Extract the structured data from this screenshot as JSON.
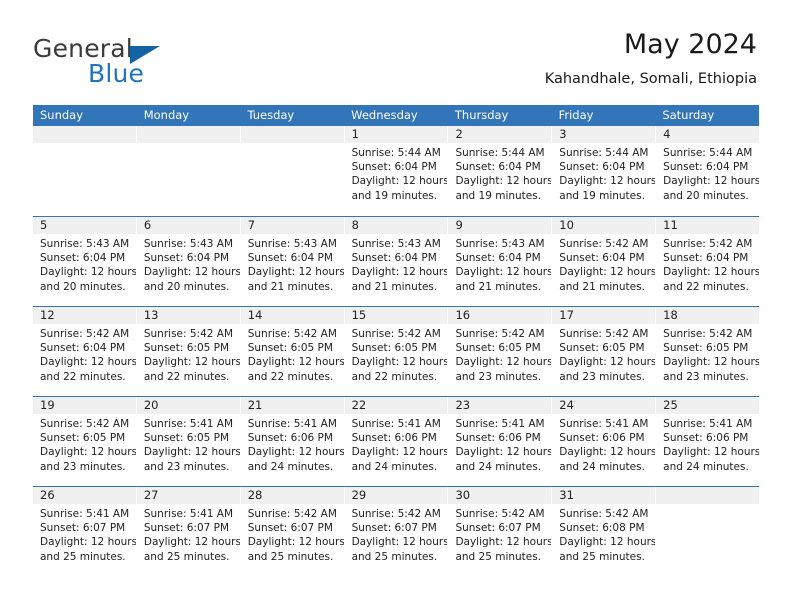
{
  "brand": {
    "name_part1": "General",
    "name_part2": "Blue",
    "triangle_icon": "triangle-icon",
    "accent_color": "#1464a5"
  },
  "header": {
    "title": "May 2024",
    "subtitle": "Kahandhale, Somali, Ethiopia"
  },
  "calendar": {
    "header_color": "#3275b8",
    "daynum_bg": "#f0f0f0",
    "day_names": [
      "Sunday",
      "Monday",
      "Tuesday",
      "Wednesday",
      "Thursday",
      "Friday",
      "Saturday"
    ],
    "weeks": [
      [
        {
          "day": "",
          "empty": true,
          "sunrise": "",
          "sunset": "",
          "daylight1": "",
          "daylight2": ""
        },
        {
          "day": "",
          "empty": true,
          "sunrise": "",
          "sunset": "",
          "daylight1": "",
          "daylight2": ""
        },
        {
          "day": "",
          "empty": true,
          "sunrise": "",
          "sunset": "",
          "daylight1": "",
          "daylight2": ""
        },
        {
          "day": "1",
          "empty": false,
          "sunrise": "Sunrise: 5:44 AM",
          "sunset": "Sunset: 6:04 PM",
          "daylight1": "Daylight: 12 hours",
          "daylight2": "and 19 minutes."
        },
        {
          "day": "2",
          "empty": false,
          "sunrise": "Sunrise: 5:44 AM",
          "sunset": "Sunset: 6:04 PM",
          "daylight1": "Daylight: 12 hours",
          "daylight2": "and 19 minutes."
        },
        {
          "day": "3",
          "empty": false,
          "sunrise": "Sunrise: 5:44 AM",
          "sunset": "Sunset: 6:04 PM",
          "daylight1": "Daylight: 12 hours",
          "daylight2": "and 19 minutes."
        },
        {
          "day": "4",
          "empty": false,
          "sunrise": "Sunrise: 5:44 AM",
          "sunset": "Sunset: 6:04 PM",
          "daylight1": "Daylight: 12 hours",
          "daylight2": "and 20 minutes."
        }
      ],
      [
        {
          "day": "5",
          "empty": false,
          "sunrise": "Sunrise: 5:43 AM",
          "sunset": "Sunset: 6:04 PM",
          "daylight1": "Daylight: 12 hours",
          "daylight2": "and 20 minutes."
        },
        {
          "day": "6",
          "empty": false,
          "sunrise": "Sunrise: 5:43 AM",
          "sunset": "Sunset: 6:04 PM",
          "daylight1": "Daylight: 12 hours",
          "daylight2": "and 20 minutes."
        },
        {
          "day": "7",
          "empty": false,
          "sunrise": "Sunrise: 5:43 AM",
          "sunset": "Sunset: 6:04 PM",
          "daylight1": "Daylight: 12 hours",
          "daylight2": "and 21 minutes."
        },
        {
          "day": "8",
          "empty": false,
          "sunrise": "Sunrise: 5:43 AM",
          "sunset": "Sunset: 6:04 PM",
          "daylight1": "Daylight: 12 hours",
          "daylight2": "and 21 minutes."
        },
        {
          "day": "9",
          "empty": false,
          "sunrise": "Sunrise: 5:43 AM",
          "sunset": "Sunset: 6:04 PM",
          "daylight1": "Daylight: 12 hours",
          "daylight2": "and 21 minutes."
        },
        {
          "day": "10",
          "empty": false,
          "sunrise": "Sunrise: 5:42 AM",
          "sunset": "Sunset: 6:04 PM",
          "daylight1": "Daylight: 12 hours",
          "daylight2": "and 21 minutes."
        },
        {
          "day": "11",
          "empty": false,
          "sunrise": "Sunrise: 5:42 AM",
          "sunset": "Sunset: 6:04 PM",
          "daylight1": "Daylight: 12 hours",
          "daylight2": "and 22 minutes."
        }
      ],
      [
        {
          "day": "12",
          "empty": false,
          "sunrise": "Sunrise: 5:42 AM",
          "sunset": "Sunset: 6:04 PM",
          "daylight1": "Daylight: 12 hours",
          "daylight2": "and 22 minutes."
        },
        {
          "day": "13",
          "empty": false,
          "sunrise": "Sunrise: 5:42 AM",
          "sunset": "Sunset: 6:05 PM",
          "daylight1": "Daylight: 12 hours",
          "daylight2": "and 22 minutes."
        },
        {
          "day": "14",
          "empty": false,
          "sunrise": "Sunrise: 5:42 AM",
          "sunset": "Sunset: 6:05 PM",
          "daylight1": "Daylight: 12 hours",
          "daylight2": "and 22 minutes."
        },
        {
          "day": "15",
          "empty": false,
          "sunrise": "Sunrise: 5:42 AM",
          "sunset": "Sunset: 6:05 PM",
          "daylight1": "Daylight: 12 hours",
          "daylight2": "and 22 minutes."
        },
        {
          "day": "16",
          "empty": false,
          "sunrise": "Sunrise: 5:42 AM",
          "sunset": "Sunset: 6:05 PM",
          "daylight1": "Daylight: 12 hours",
          "daylight2": "and 23 minutes."
        },
        {
          "day": "17",
          "empty": false,
          "sunrise": "Sunrise: 5:42 AM",
          "sunset": "Sunset: 6:05 PM",
          "daylight1": "Daylight: 12 hours",
          "daylight2": "and 23 minutes."
        },
        {
          "day": "18",
          "empty": false,
          "sunrise": "Sunrise: 5:42 AM",
          "sunset": "Sunset: 6:05 PM",
          "daylight1": "Daylight: 12 hours",
          "daylight2": "and 23 minutes."
        }
      ],
      [
        {
          "day": "19",
          "empty": false,
          "sunrise": "Sunrise: 5:42 AM",
          "sunset": "Sunset: 6:05 PM",
          "daylight1": "Daylight: 12 hours",
          "daylight2": "and 23 minutes."
        },
        {
          "day": "20",
          "empty": false,
          "sunrise": "Sunrise: 5:41 AM",
          "sunset": "Sunset: 6:05 PM",
          "daylight1": "Daylight: 12 hours",
          "daylight2": "and 23 minutes."
        },
        {
          "day": "21",
          "empty": false,
          "sunrise": "Sunrise: 5:41 AM",
          "sunset": "Sunset: 6:06 PM",
          "daylight1": "Daylight: 12 hours",
          "daylight2": "and 24 minutes."
        },
        {
          "day": "22",
          "empty": false,
          "sunrise": "Sunrise: 5:41 AM",
          "sunset": "Sunset: 6:06 PM",
          "daylight1": "Daylight: 12 hours",
          "daylight2": "and 24 minutes."
        },
        {
          "day": "23",
          "empty": false,
          "sunrise": "Sunrise: 5:41 AM",
          "sunset": "Sunset: 6:06 PM",
          "daylight1": "Daylight: 12 hours",
          "daylight2": "and 24 minutes."
        },
        {
          "day": "24",
          "empty": false,
          "sunrise": "Sunrise: 5:41 AM",
          "sunset": "Sunset: 6:06 PM",
          "daylight1": "Daylight: 12 hours",
          "daylight2": "and 24 minutes."
        },
        {
          "day": "25",
          "empty": false,
          "sunrise": "Sunrise: 5:41 AM",
          "sunset": "Sunset: 6:06 PM",
          "daylight1": "Daylight: 12 hours",
          "daylight2": "and 24 minutes."
        }
      ],
      [
        {
          "day": "26",
          "empty": false,
          "sunrise": "Sunrise: 5:41 AM",
          "sunset": "Sunset: 6:07 PM",
          "daylight1": "Daylight: 12 hours",
          "daylight2": "and 25 minutes."
        },
        {
          "day": "27",
          "empty": false,
          "sunrise": "Sunrise: 5:41 AM",
          "sunset": "Sunset: 6:07 PM",
          "daylight1": "Daylight: 12 hours",
          "daylight2": "and 25 minutes."
        },
        {
          "day": "28",
          "empty": false,
          "sunrise": "Sunrise: 5:42 AM",
          "sunset": "Sunset: 6:07 PM",
          "daylight1": "Daylight: 12 hours",
          "daylight2": "and 25 minutes."
        },
        {
          "day": "29",
          "empty": false,
          "sunrise": "Sunrise: 5:42 AM",
          "sunset": "Sunset: 6:07 PM",
          "daylight1": "Daylight: 12 hours",
          "daylight2": "and 25 minutes."
        },
        {
          "day": "30",
          "empty": false,
          "sunrise": "Sunrise: 5:42 AM",
          "sunset": "Sunset: 6:07 PM",
          "daylight1": "Daylight: 12 hours",
          "daylight2": "and 25 minutes."
        },
        {
          "day": "31",
          "empty": false,
          "sunrise": "Sunrise: 5:42 AM",
          "sunset": "Sunset: 6:08 PM",
          "daylight1": "Daylight: 12 hours",
          "daylight2": "and 25 minutes."
        },
        {
          "day": "",
          "empty": true,
          "sunrise": "",
          "sunset": "",
          "daylight1": "",
          "daylight2": ""
        }
      ]
    ]
  }
}
